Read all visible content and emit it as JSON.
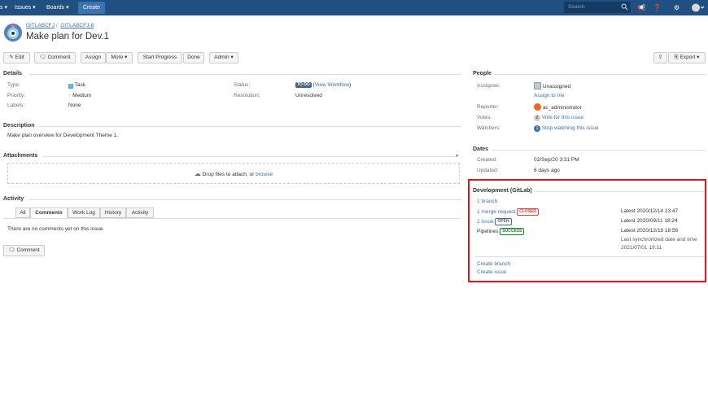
{
  "nav": {
    "truncated_item": "s",
    "issues": "Issues",
    "boards": "Boards",
    "create": "Create",
    "search_placeholder": "Search"
  },
  "header": {
    "breadcrumb_project": "GITLABCFJ",
    "breadcrumb_sep": "/",
    "breadcrumb_issue": "GITLABCFJ-8",
    "title": "Make plan for Dev.1"
  },
  "toolbar": {
    "edit": "Edit",
    "comment": "Comment",
    "assign": "Assign",
    "more": "More",
    "start_progress": "Start Progress",
    "done": "Done",
    "admin": "Admin",
    "export": "Export"
  },
  "details": {
    "heading": "Details",
    "type_label": "Type:",
    "type_value": "Task",
    "priority_label": "Priority:",
    "priority_value": "Medium",
    "labels_label": "Labels:",
    "labels_value": "None",
    "status_label": "Status:",
    "status_value": "TO DO",
    "status_link_open": "(",
    "status_link": "View Workflow",
    "status_link_close": ")",
    "resolution_label": "Resolution:",
    "resolution_value": "Unresolved"
  },
  "description": {
    "heading": "Description",
    "text": "Make plan overview for Development Theme 1."
  },
  "attachments": {
    "heading": "Attachments",
    "drop_text": "Drop files to attach, or",
    "browse": "browse"
  },
  "activity": {
    "heading": "Activity",
    "tabs": [
      "All",
      "Comments",
      "Work Log",
      "History",
      "Activity"
    ],
    "empty_text": "There are no comments yet on this issue.",
    "comment_button": "Comment"
  },
  "people": {
    "heading": "People",
    "assignee_label": "Assignee:",
    "assignee_value": "Unassigned",
    "assign_to_me": "Assign to me",
    "reporter_label": "Reporter:",
    "reporter_value": "ac_administrator",
    "votes_label": "Votes:",
    "votes_count": "0",
    "vote_link": "Vote for this issue",
    "watchers_label": "Watchers:",
    "watchers_count": "1",
    "watch_link": "Stop watching this issue"
  },
  "dates": {
    "heading": "Dates",
    "created_label": "Created:",
    "created_value": "02/Sep/20 3:31 PM",
    "updated_label": "Updated:",
    "updated_value": "6 days ago"
  },
  "development": {
    "heading": "Development (GitLab)",
    "branch_link": "1 branch",
    "merge_link": "1 merge request",
    "merge_status": "CLOSED",
    "merge_date": "Latest 2020/12/14 13:47",
    "issue_link": "1 issue",
    "issue_status": "OPEN",
    "issue_date": "Latest 2020/09/11 18:24",
    "pipelines_label": "Pipelines",
    "pipelines_status": "SUCCESS",
    "pipelines_date": "Latest 2020/12/18 18:56",
    "sync_label": "Last synchronized date and time",
    "sync_value": "2021/07/01 19:11",
    "create_branch": "Create branch",
    "create_issue": "Create issue"
  },
  "colors": {
    "nav_bg": "#205081",
    "link": "#3b73af",
    "highlight_border": "#e0141e"
  }
}
